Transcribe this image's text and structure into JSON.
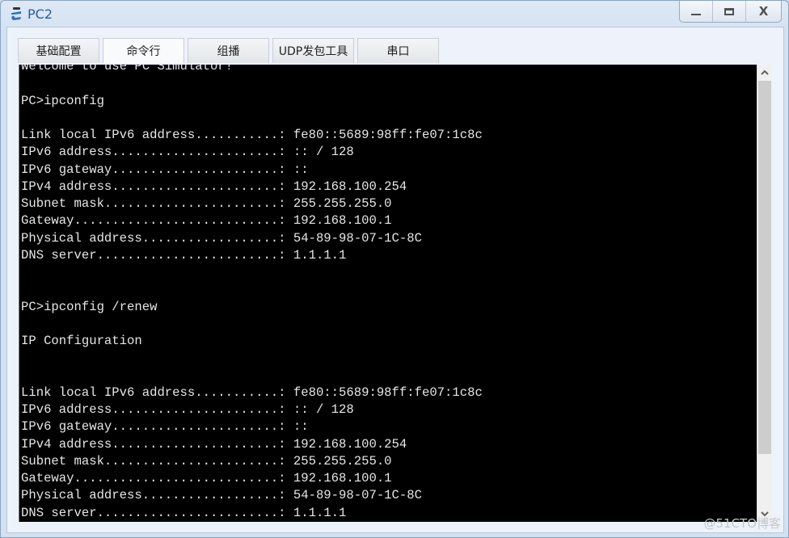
{
  "window": {
    "title": "PC2",
    "icon": "network-pc-icon",
    "controls": {
      "minimize": "minimize-icon",
      "maximize": "maximize-icon",
      "close_label": "X"
    }
  },
  "tabs": [
    {
      "label": "基础配置",
      "active": false
    },
    {
      "label": "命令行",
      "active": true
    },
    {
      "label": "组播",
      "active": false
    },
    {
      "label": "UDP发包工具",
      "active": false
    },
    {
      "label": "串口",
      "active": false
    }
  ],
  "terminal": {
    "lines": [
      "Welcome to use PC Simulator!",
      "",
      "PC>ipconfig",
      "",
      "Link local IPv6 address...........: fe80::5689:98ff:fe07:1c8c",
      "IPv6 address......................: :: / 128",
      "IPv6 gateway......................: ::",
      "IPv4 address......................: 192.168.100.254",
      "Subnet mask.......................: 255.255.255.0",
      "Gateway...........................: 192.168.100.1",
      "Physical address..................: 54-89-98-07-1C-8C",
      "DNS server........................: 1.1.1.1",
      "",
      "",
      "PC>ipconfig /renew",
      "",
      "IP Configuration",
      "",
      "",
      "Link local IPv6 address...........: fe80::5689:98ff:fe07:1c8c",
      "IPv6 address......................: :: / 128",
      "IPv6 gateway......................: ::",
      "IPv4 address......................: 192.168.100.254",
      "Subnet mask.......................: 255.255.255.0",
      "Gateway...........................: 192.168.100.1",
      "Physical address..................: 54-89-98-07-1C-8C",
      "DNS server........................: 1.1.1.1"
    ]
  },
  "scrollbar": {
    "up_icon": "chevron-up-icon",
    "down_icon": "chevron-down-icon",
    "position": "bottom"
  },
  "watermark": "@51CTO博客"
}
